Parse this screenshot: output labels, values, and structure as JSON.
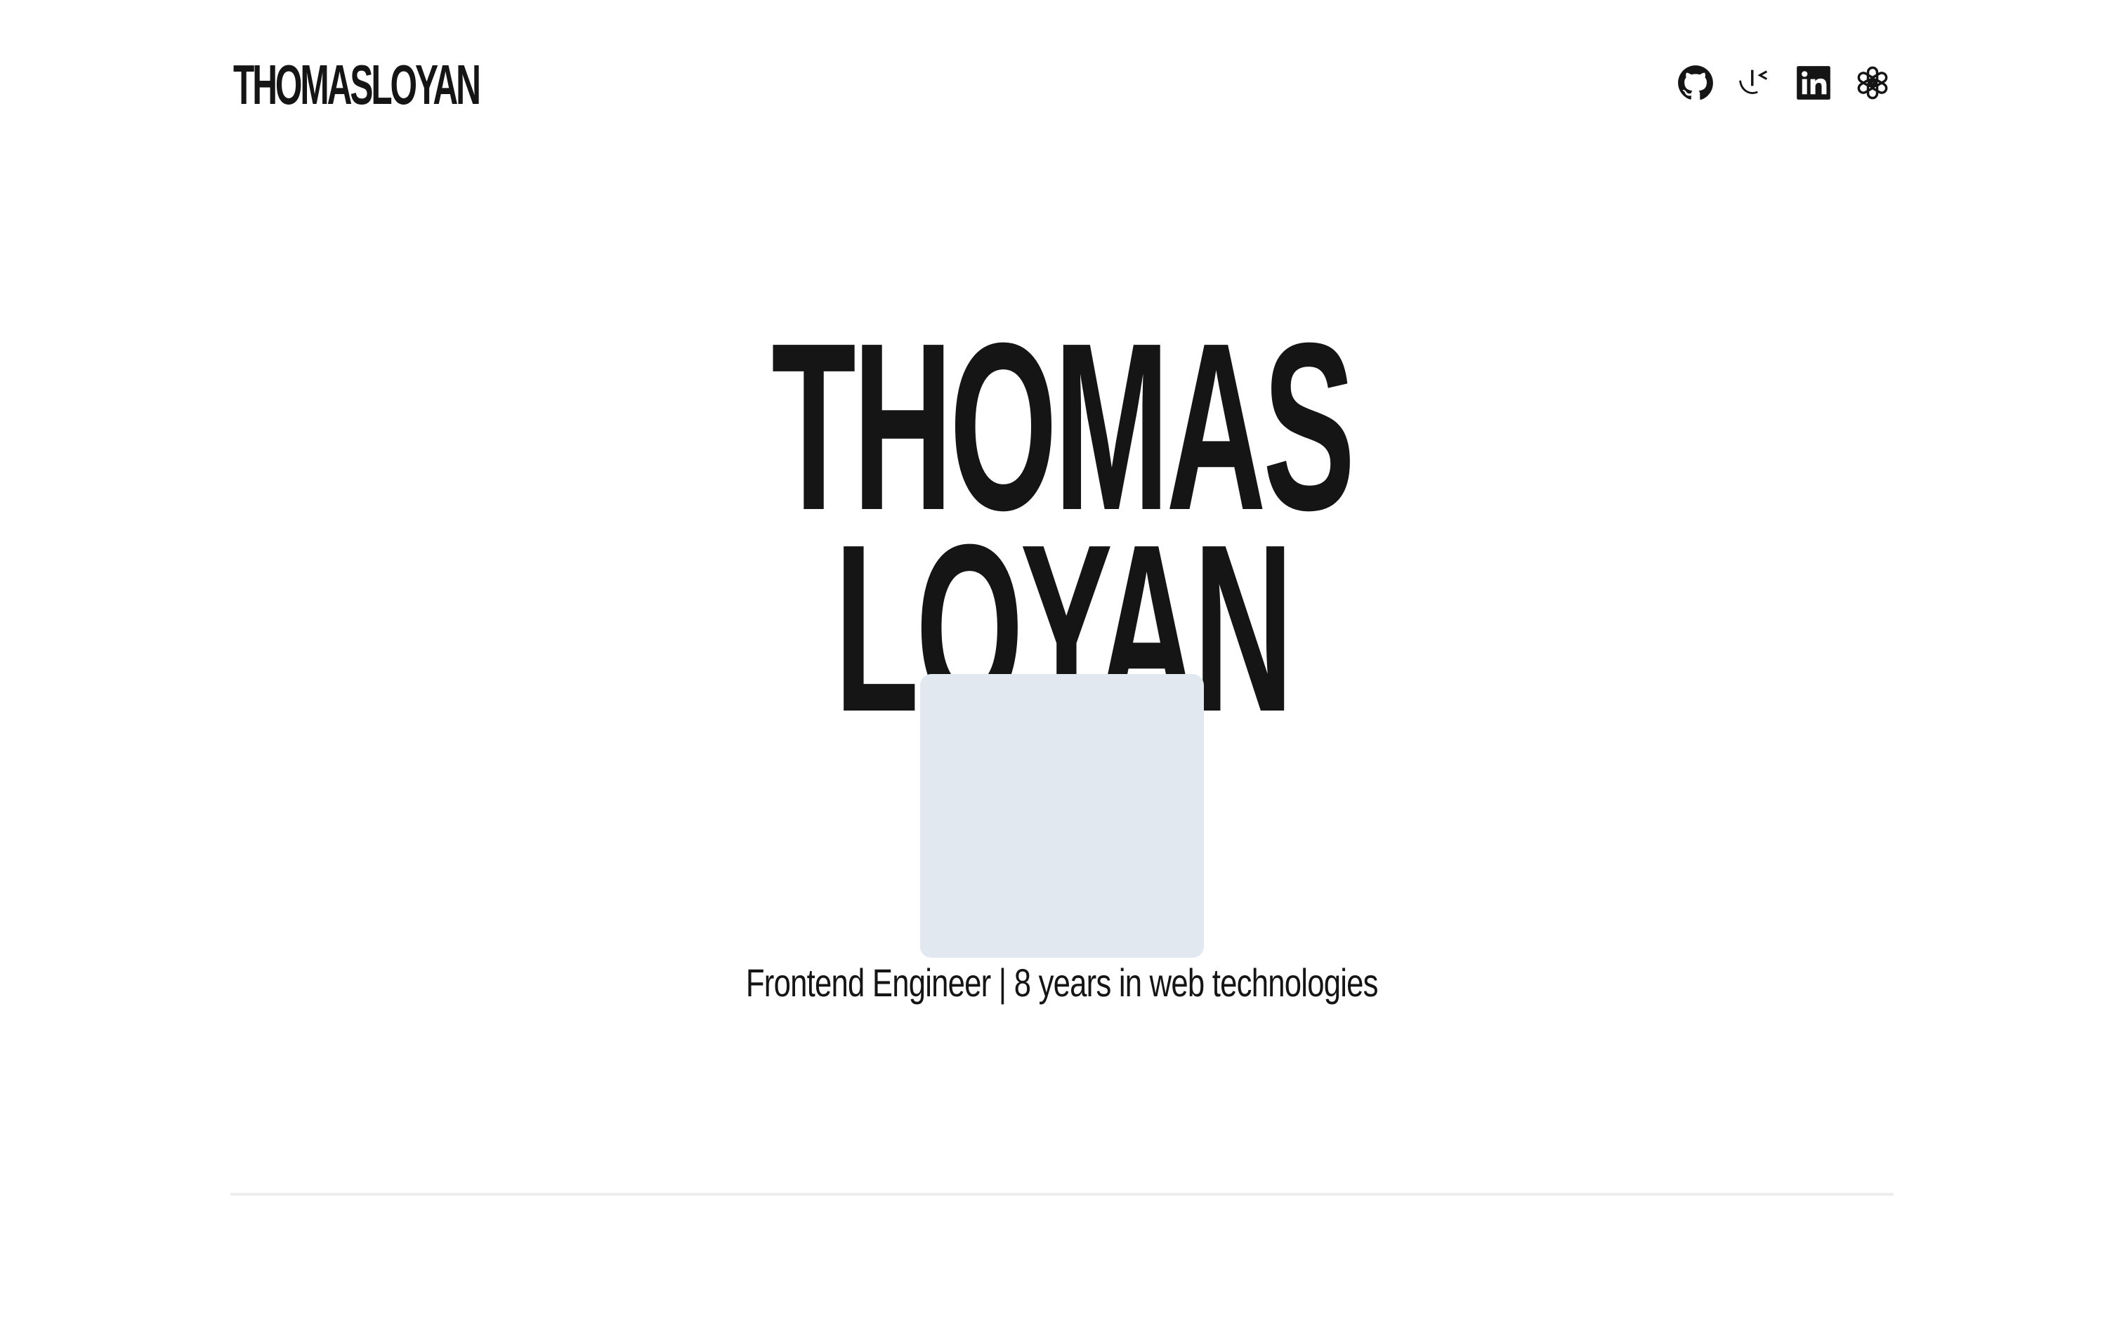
{
  "header": {
    "logo_text": "THOMASLOYAN",
    "social_links": [
      {
        "icon": "github-icon"
      },
      {
        "icon": "custom-monogram-icon"
      },
      {
        "icon": "linkedin-icon"
      },
      {
        "icon": "openai-icon"
      }
    ]
  },
  "hero": {
    "first_name": "THOMAS",
    "last_name": "LOYAN",
    "tagline": "Frontend Engineer | 8 years in web technologies"
  },
  "colors": {
    "text": "#151515",
    "background": "#ffffff",
    "photo_placeholder": "#e1e8f0",
    "divider": "#ededed"
  }
}
